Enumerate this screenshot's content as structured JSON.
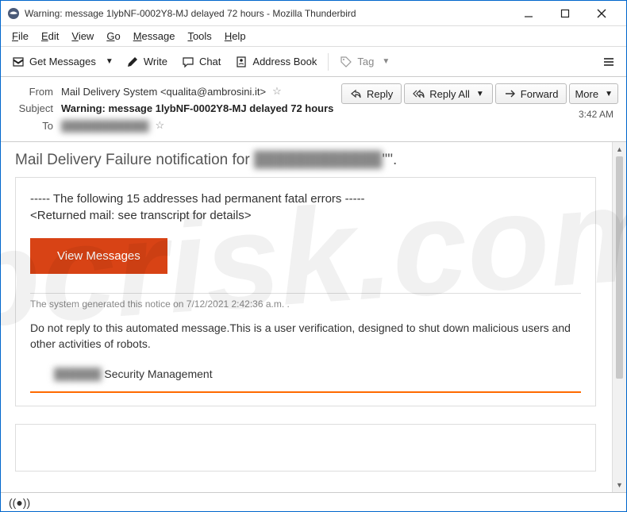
{
  "window": {
    "title": "Warning: message 1lybNF-0002Y8-MJ delayed 72 hours - Mozilla Thunderbird"
  },
  "menubar": {
    "file": "File",
    "edit": "Edit",
    "view": "View",
    "go": "Go",
    "message": "Message",
    "tools": "Tools",
    "help": "Help"
  },
  "toolbar": {
    "get_messages": "Get Messages",
    "write": "Write",
    "chat": "Chat",
    "address_book": "Address Book",
    "tag": "Tag"
  },
  "header": {
    "from_label": "From",
    "from_value": "Mail Delivery System <qualita@ambrosini.it>",
    "subject_label": "Subject",
    "subject_value": "Warning: message 1lybNF-0002Y8-MJ delayed 72 hours",
    "to_label": "To",
    "to_value_blurred": "████████████",
    "time": "3:42 AM"
  },
  "actions": {
    "reply": "Reply",
    "reply_all": "Reply All",
    "forward": "Forward",
    "more": "More"
  },
  "body": {
    "notif_prefix": "Mail Delivery Failure notification for ",
    "notif_blurred": "████████████",
    "notif_suffix": "\"\".",
    "err_line1": " ----- The following 15 addresses had permanent fatal errors -----",
    "err_line2": "<Returned mail: see transcript for details>",
    "view_btn": "View Messages",
    "gen_notice": "The system generated this notice on 7/12/2021 2:42:36 a.m. .",
    "noreply": "Do not reply to this automated message.This is a user verification, designed to shut down malicious users and other  activities of  robots.",
    "secmgmt_blurred": "██████",
    "secmgmt_suffix": " Security Management"
  },
  "watermark": "pcrisk.com"
}
